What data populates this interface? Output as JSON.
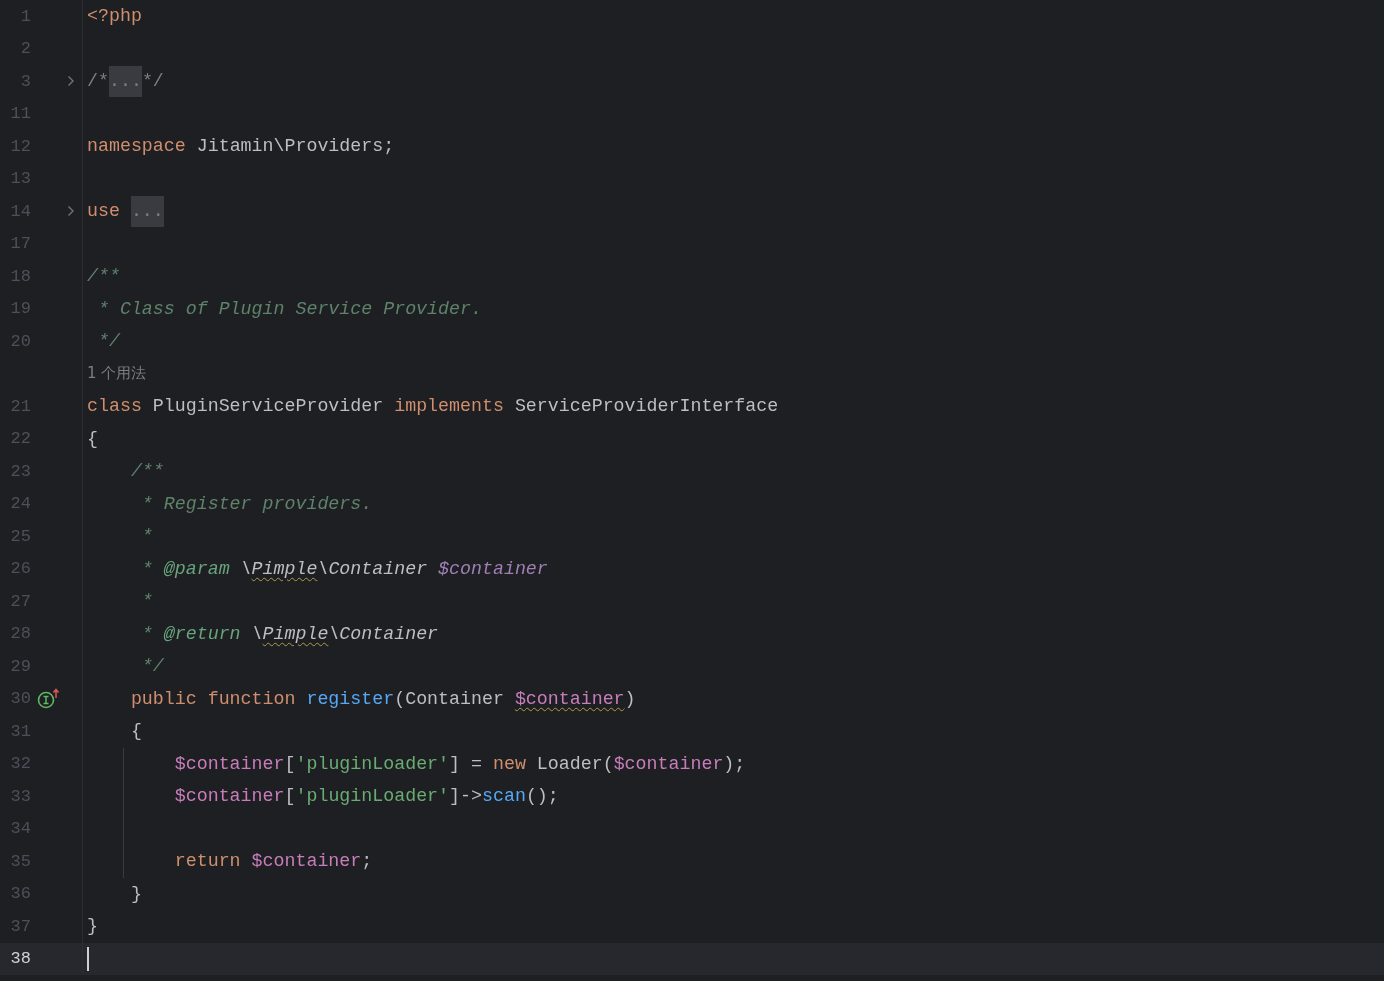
{
  "editor": {
    "lines": [
      {
        "kind": "code",
        "number": "1",
        "folded": false,
        "current": false,
        "guide": false,
        "tokens": [
          {
            "kind": "keyword",
            "text": "<?php"
          }
        ]
      },
      {
        "kind": "code",
        "number": "2",
        "folded": false,
        "current": false,
        "guide": false
      },
      {
        "kind": "code",
        "number": "3",
        "folded": true,
        "current": false,
        "guide": false,
        "tokens": [
          {
            "kind": "comment",
            "text": "/*"
          },
          {
            "kind": "fold",
            "text": "..."
          },
          {
            "kind": "comment",
            "text": "*/"
          }
        ]
      },
      {
        "kind": "code",
        "number": "11",
        "folded": false,
        "current": false,
        "guide": false
      },
      {
        "kind": "code",
        "number": "12",
        "folded": false,
        "current": false,
        "guide": false,
        "tokens": [
          {
            "kind": "keyword",
            "text": "namespace"
          },
          {
            "kind": "plain",
            "text": " Jitamin\\Providers;"
          }
        ]
      },
      {
        "kind": "code",
        "number": "13",
        "folded": false,
        "current": false,
        "guide": false
      },
      {
        "kind": "code",
        "number": "14",
        "folded": true,
        "current": false,
        "guide": false,
        "tokens": [
          {
            "kind": "keyword",
            "text": "use "
          },
          {
            "kind": "fold",
            "text": "..."
          }
        ]
      },
      {
        "kind": "code",
        "number": "17",
        "folded": false,
        "current": false,
        "guide": false
      },
      {
        "kind": "code",
        "number": "18",
        "folded": false,
        "current": false,
        "guide": false,
        "tokens": [
          {
            "kind": "doc",
            "text": "/**"
          }
        ]
      },
      {
        "kind": "code",
        "number": "19",
        "folded": false,
        "current": false,
        "guide": false,
        "tokens": [
          {
            "kind": "doc",
            "text": " * Class of Plugin Service Provider."
          }
        ]
      },
      {
        "kind": "code",
        "number": "20",
        "folded": false,
        "current": false,
        "guide": false,
        "tokens": [
          {
            "kind": "doc",
            "text": " */"
          }
        ]
      },
      {
        "kind": "hint",
        "text": "1 个用法"
      },
      {
        "kind": "code",
        "number": "21",
        "folded": false,
        "current": false,
        "guide": false,
        "tokens": [
          {
            "kind": "keyword",
            "text": "class"
          },
          {
            "kind": "plain",
            "text": " PluginServiceProvider "
          },
          {
            "kind": "keyword",
            "text": "implements"
          },
          {
            "kind": "plain",
            "text": " ServiceProviderInterface"
          }
        ]
      },
      {
        "kind": "code",
        "number": "22",
        "folded": false,
        "current": false,
        "guide": false,
        "tokens": [
          {
            "kind": "plain",
            "text": "{"
          }
        ]
      },
      {
        "kind": "code",
        "number": "23",
        "folded": false,
        "current": false,
        "guide": false,
        "tokens": [
          {
            "kind": "doc",
            "text": "    /**"
          }
        ]
      },
      {
        "kind": "code",
        "number": "24",
        "folded": false,
        "current": false,
        "guide": false,
        "tokens": [
          {
            "kind": "doc",
            "text": "     * Register providers."
          }
        ]
      },
      {
        "kind": "code",
        "number": "25",
        "folded": false,
        "current": false,
        "guide": false,
        "tokens": [
          {
            "kind": "doc",
            "text": "     *"
          }
        ]
      },
      {
        "kind": "code",
        "number": "26",
        "folded": false,
        "current": false,
        "guide": false,
        "tokens": [
          {
            "kind": "doc",
            "text": "     * "
          },
          {
            "kind": "doctag",
            "text": "@param"
          },
          {
            "kind": "docplain",
            "text": " \\"
          },
          {
            "kind": "docplain",
            "text": "Pimple",
            "warning": true
          },
          {
            "kind": "docplain",
            "text": "\\Container "
          },
          {
            "kind": "docvar",
            "text": "$container"
          }
        ]
      },
      {
        "kind": "code",
        "number": "27",
        "folded": false,
        "current": false,
        "guide": false,
        "tokens": [
          {
            "kind": "doc",
            "text": "     *"
          }
        ]
      },
      {
        "kind": "code",
        "number": "28",
        "folded": false,
        "current": false,
        "guide": false,
        "tokens": [
          {
            "kind": "doc",
            "text": "     * "
          },
          {
            "kind": "doctag",
            "text": "@return"
          },
          {
            "kind": "docplain",
            "text": " \\"
          },
          {
            "kind": "docplain",
            "text": "Pimple",
            "warning": true
          },
          {
            "kind": "docplain",
            "text": "\\Container"
          }
        ]
      },
      {
        "kind": "code",
        "number": "29",
        "folded": false,
        "current": false,
        "guide": false,
        "tokens": [
          {
            "kind": "doc",
            "text": "     */"
          }
        ]
      },
      {
        "kind": "code",
        "number": "30",
        "folded": false,
        "current": false,
        "guide": false,
        "implements_marker": true,
        "tokens": [
          {
            "kind": "keyword",
            "text": "    public function "
          },
          {
            "kind": "method",
            "text": "register"
          },
          {
            "kind": "plain",
            "text": "(Container "
          },
          {
            "kind": "variable",
            "text": "$container",
            "warning": true
          },
          {
            "kind": "plain",
            "text": ")"
          }
        ]
      },
      {
        "kind": "code",
        "number": "31",
        "folded": false,
        "current": false,
        "guide": false,
        "tokens": [
          {
            "kind": "plain",
            "text": "    {"
          }
        ]
      },
      {
        "kind": "code",
        "number": "32",
        "folded": false,
        "current": false,
        "guide": true,
        "tokens": [
          {
            "kind": "variable",
            "text": "        $container"
          },
          {
            "kind": "plain",
            "text": "["
          },
          {
            "kind": "string",
            "text": "'pluginLoader'"
          },
          {
            "kind": "plain",
            "text": "] = "
          },
          {
            "kind": "keyword",
            "text": "new"
          },
          {
            "kind": "plain",
            "text": " Loader("
          },
          {
            "kind": "variable",
            "text": "$container"
          },
          {
            "kind": "plain",
            "text": ");"
          }
        ]
      },
      {
        "kind": "code",
        "number": "33",
        "folded": false,
        "current": false,
        "guide": true,
        "tokens": [
          {
            "kind": "variable",
            "text": "        $container"
          },
          {
            "kind": "plain",
            "text": "["
          },
          {
            "kind": "string",
            "text": "'pluginLoader'"
          },
          {
            "kind": "plain",
            "text": "]->"
          },
          {
            "kind": "method",
            "text": "scan"
          },
          {
            "kind": "plain",
            "text": "();"
          }
        ]
      },
      {
        "kind": "code",
        "number": "34",
        "folded": false,
        "current": false,
        "guide": true
      },
      {
        "kind": "code",
        "number": "35",
        "folded": false,
        "current": false,
        "guide": true,
        "tokens": [
          {
            "kind": "keyword",
            "text": "        return "
          },
          {
            "kind": "variable",
            "text": "$container"
          },
          {
            "kind": "plain",
            "text": ";"
          }
        ]
      },
      {
        "kind": "code",
        "number": "36",
        "folded": false,
        "current": false,
        "guide": false,
        "tokens": [
          {
            "kind": "plain",
            "text": "    }"
          }
        ]
      },
      {
        "kind": "code",
        "number": "37",
        "folded": false,
        "current": false,
        "guide": false,
        "tokens": [
          {
            "kind": "plain",
            "text": "}"
          }
        ]
      },
      {
        "kind": "code",
        "number": "38",
        "folded": false,
        "current": true,
        "guide": false
      }
    ]
  }
}
